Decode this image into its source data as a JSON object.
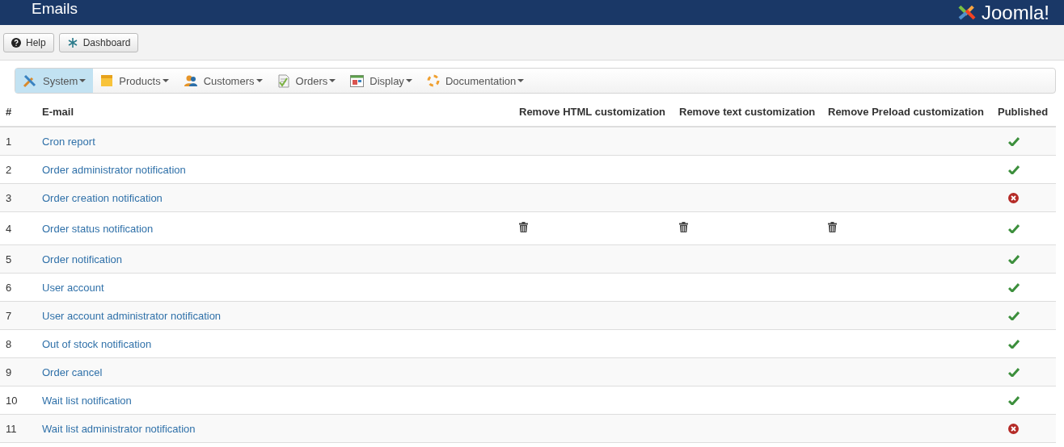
{
  "header": {
    "title": "Emails",
    "logo": "Joomla!"
  },
  "toolbar": [
    "Help",
    "Dashboard"
  ],
  "menu": [
    {
      "label": "System",
      "selected": true
    },
    {
      "label": "Products",
      "selected": false
    },
    {
      "label": "Customers",
      "selected": false
    },
    {
      "label": "Orders",
      "selected": false
    },
    {
      "label": "Display",
      "selected": false
    },
    {
      "label": "Documentation",
      "selected": false
    }
  ],
  "table": {
    "columns": [
      "#",
      "E-mail",
      "Remove HTML customization",
      "Remove text customization",
      "Remove Preload customization",
      "Published"
    ],
    "rows": [
      {
        "num": "1",
        "email": "Cron report",
        "html": false,
        "text": false,
        "preload": false,
        "published": true
      },
      {
        "num": "2",
        "email": "Order administrator notification",
        "html": false,
        "text": false,
        "preload": false,
        "published": true
      },
      {
        "num": "3",
        "email": "Order creation notification",
        "html": false,
        "text": false,
        "preload": false,
        "published": false
      },
      {
        "num": "4",
        "email": "Order status notification",
        "html": true,
        "text": true,
        "preload": true,
        "published": true
      },
      {
        "num": "5",
        "email": "Order notification",
        "html": false,
        "text": false,
        "preload": false,
        "published": true
      },
      {
        "num": "6",
        "email": "User account",
        "html": false,
        "text": false,
        "preload": false,
        "published": true
      },
      {
        "num": "7",
        "email": "User account administrator notification",
        "html": false,
        "text": false,
        "preload": false,
        "published": true
      },
      {
        "num": "8",
        "email": "Out of stock notification",
        "html": false,
        "text": false,
        "preload": false,
        "published": true
      },
      {
        "num": "9",
        "email": "Order cancel",
        "html": false,
        "text": false,
        "preload": false,
        "published": true
      },
      {
        "num": "10",
        "email": "Wait list notification",
        "html": false,
        "text": false,
        "preload": false,
        "published": true
      },
      {
        "num": "11",
        "email": "Wait list administrator notification",
        "html": false,
        "text": false,
        "preload": false,
        "published": false
      }
    ]
  }
}
